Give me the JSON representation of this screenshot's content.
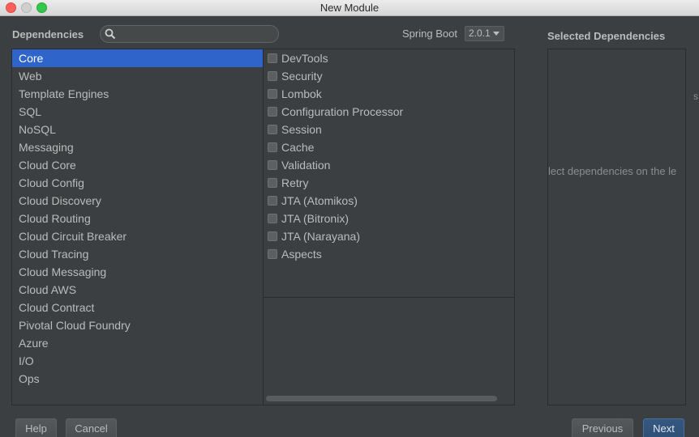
{
  "window": {
    "title": "New Module"
  },
  "header": {
    "dependencies_label": "Dependencies",
    "search_placeholder": "",
    "spring_boot_label": "Spring Boot",
    "spring_boot_version": "2.0.1",
    "selected_label": "Selected Dependencies"
  },
  "categories": [
    "Core",
    "Web",
    "Template Engines",
    "SQL",
    "NoSQL",
    "Messaging",
    "Cloud Core",
    "Cloud Config",
    "Cloud Discovery",
    "Cloud Routing",
    "Cloud Circuit Breaker",
    "Cloud Tracing",
    "Cloud Messaging",
    "Cloud AWS",
    "Cloud Contract",
    "Pivotal Cloud Foundry",
    "Azure",
    "I/O",
    "Ops"
  ],
  "selected_category": "Core",
  "dependencies": [
    "DevTools",
    "Security",
    "Lombok",
    "Configuration Processor",
    "Session",
    "Cache",
    "Validation",
    "Retry",
    "JTA (Atomikos)",
    "JTA (Bitronix)",
    "JTA (Narayana)",
    "Aspects"
  ],
  "selected_panel": {
    "hint": "lect dependencies on the le",
    "edge_mark": "s"
  },
  "buttons": {
    "help": "Help",
    "cancel": "Cancel",
    "previous": "Previous",
    "next": "Next"
  },
  "colors": {
    "accent": "#2f65ca",
    "background": "#3c3f41",
    "next_button": "#365880"
  }
}
